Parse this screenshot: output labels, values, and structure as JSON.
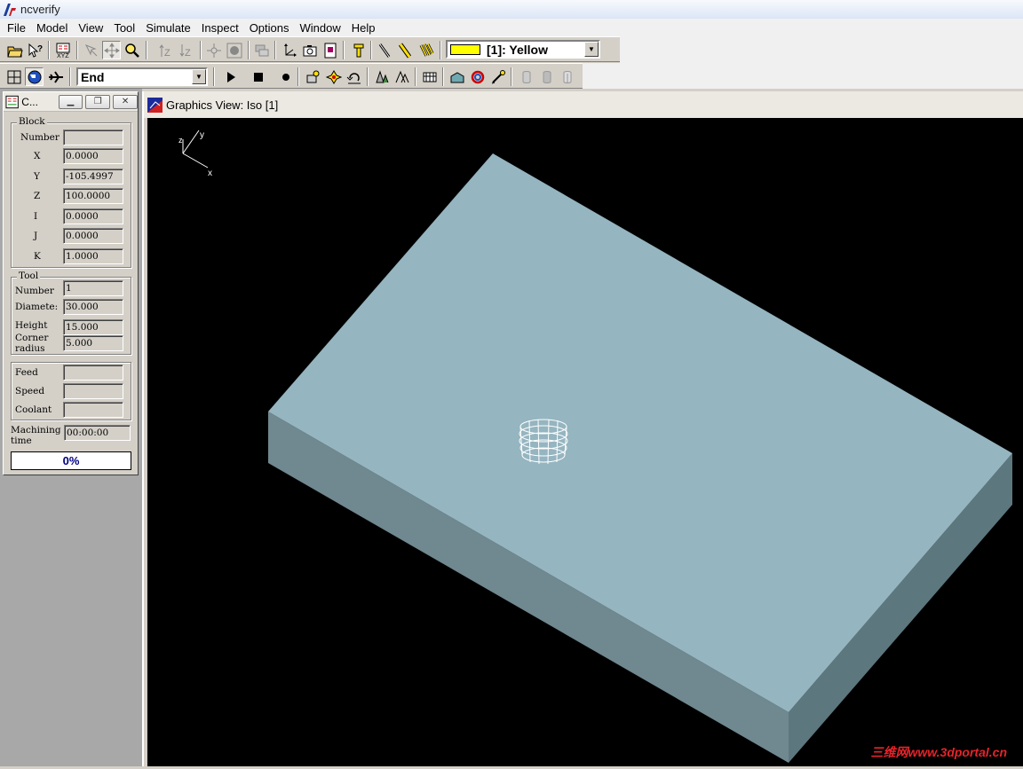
{
  "app": {
    "title": "ncverify"
  },
  "menu": [
    "File",
    "Model",
    "View",
    "Tool",
    "Simulate",
    "Inspect",
    "Options",
    "Window",
    "Help"
  ],
  "toolbar": {
    "color_combo_value": "[1]: Yellow",
    "color_combo_swatch": "#ffff00",
    "mode_combo_value": "End"
  },
  "control_panel": {
    "title": "C...",
    "block": {
      "label": "Block",
      "number_label": "Number",
      "number": "",
      "x_label": "X",
      "x": "0.0000",
      "y_label": "Y",
      "y": "-105.4997",
      "z_label": "Z",
      "z": "100.0000",
      "i_label": "I",
      "i": "0.0000",
      "j_label": "J",
      "j": "0.0000",
      "k_label": "K",
      "k": "1.0000"
    },
    "tool": {
      "label": "Tool",
      "number_label": "Number",
      "number": "1",
      "diameter_label": "Diamete:",
      "diameter": "30.000",
      "height_label": "Height",
      "height": "15.000",
      "corner_label_1": "Corner",
      "corner_label_2": "radius",
      "corner_radius": "5.000"
    },
    "feed_label": "Feed",
    "feed": "",
    "speed_label": "Speed",
    "speed": "",
    "coolant_label": "Coolant",
    "coolant": "",
    "machining_label_1": "Machining",
    "machining_label_2": "time",
    "machining_time": "00:00:00",
    "progress_text": "0%",
    "progress_fraction": 0
  },
  "graphics": {
    "title": "Graphics View: Iso [1]",
    "axis_z": "z",
    "axis_y": "y",
    "axis_x": "x",
    "stock_top_color": "#95b5c0",
    "stock_left_color": "#70888f",
    "stock_right_color": "#5d777e"
  },
  "watermark": "三维网www.3dportal.cn"
}
